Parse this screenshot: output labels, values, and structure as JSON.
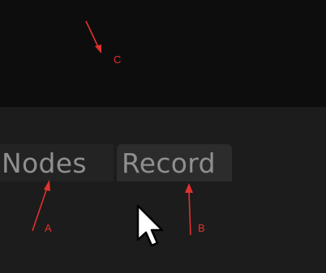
{
  "tabs": [
    {
      "label": "Nodes"
    },
    {
      "label": "Record"
    }
  ],
  "annotations": {
    "a": "A",
    "b": "B",
    "c": "C"
  },
  "colors": {
    "annotation_red": "#e0322d",
    "tab_text": "#8f8f8f",
    "panel_bg": "#1c1c1c",
    "top_bg": "#0d0d0d"
  },
  "icons": {
    "cursor": "mouse-pointer-icon",
    "arrow": "red-annotation-arrow-icon"
  }
}
